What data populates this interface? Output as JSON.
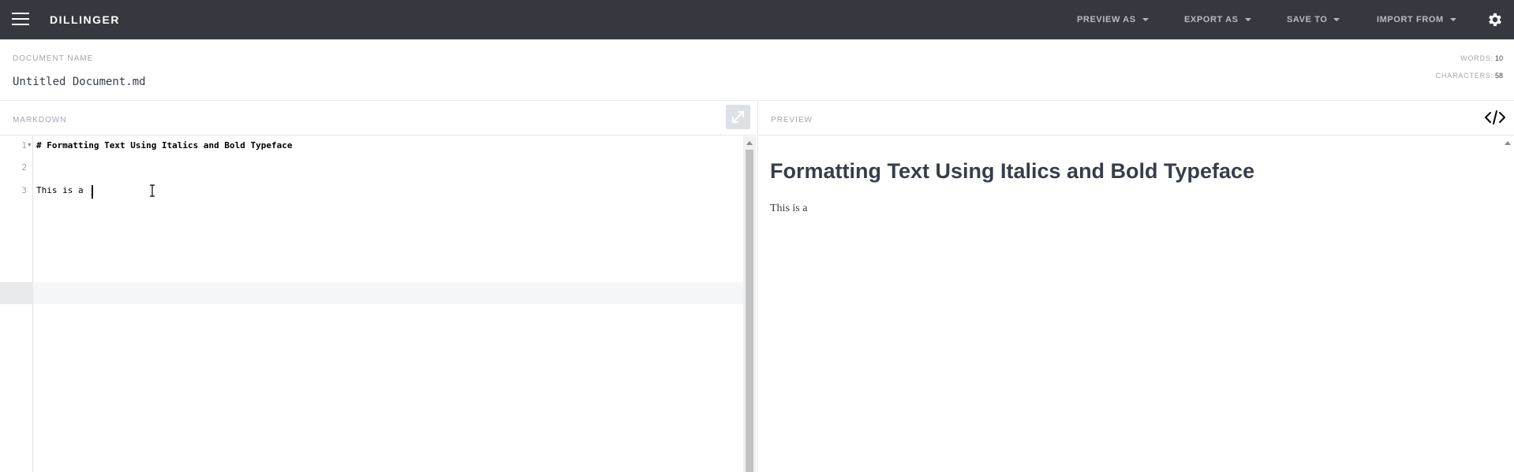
{
  "app": {
    "brand": "DILLINGER"
  },
  "nav": {
    "menus": [
      {
        "label": "PREVIEW AS"
      },
      {
        "label": "EXPORT AS"
      },
      {
        "label": "SAVE TO"
      },
      {
        "label": "IMPORT FROM"
      }
    ],
    "icons": [
      "hamburger-icon",
      "gear-icon"
    ]
  },
  "document": {
    "label": "DOCUMENT NAME",
    "name": "Untitled Document.md",
    "words_label": "WORDS:",
    "words": "10",
    "characters_label": "CHARACTERS:",
    "characters": "58"
  },
  "editor": {
    "title": "MARKDOWN",
    "lines": [
      {
        "number": "1",
        "text": "# Formatting Text Using Italics and Bold Typeface"
      },
      {
        "number": "2",
        "text": ""
      },
      {
        "number": "3",
        "text": "This is a "
      }
    ],
    "active_line": 3
  },
  "preview": {
    "title": "PREVIEW",
    "heading": "Formatting Text Using Italics and Bold Typeface",
    "paragraph": "This is a"
  },
  "colors": {
    "navbar": "#35393f",
    "nav_text": "#b6bcc6",
    "text": "#373d49",
    "muted": "#a0a6b0"
  }
}
